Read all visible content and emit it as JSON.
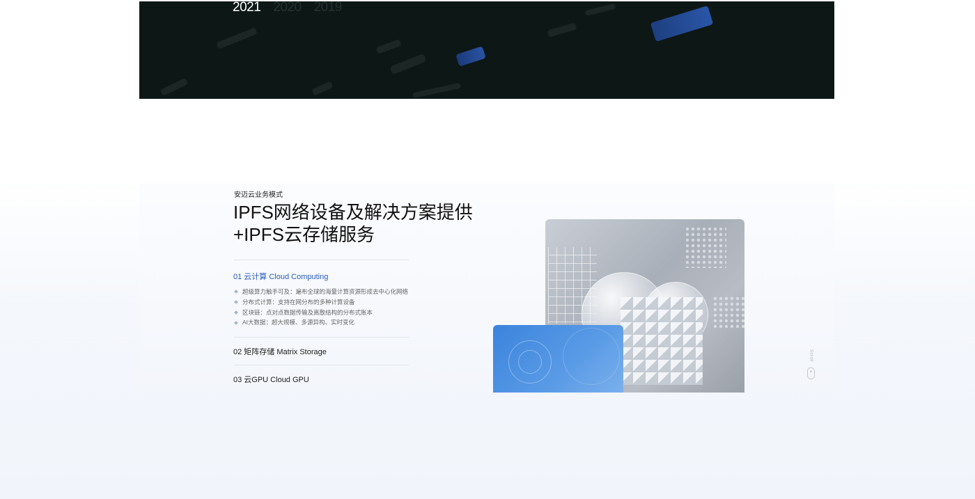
{
  "hero": {
    "years": [
      "2021",
      "2020",
      "2019"
    ],
    "active_year": "2021"
  },
  "section": {
    "eyebrow": "安迈云业务模式",
    "headline_line1": "IPFS网络设备及解决方案提供",
    "headline_line2": "+IPFS云存储服务"
  },
  "accordion": [
    {
      "title": "01 云计算 Cloud Computing",
      "expanded": true,
      "features": [
        "超级算力触手可及：遍布全球的海量计算资源形成去中心化网络",
        "分布式计算：支持在网分布的多种计算设备",
        "区块链：点对点数据传输及离散结构的分布式账本",
        "AI大数据：超大规模、多源异构、实时变化"
      ]
    },
    {
      "title": "02 矩阵存储 Matrix Storage",
      "expanded": false
    },
    {
      "title": "03 云GPU Cloud GPU",
      "expanded": false
    }
  ],
  "scroll_hint": {
    "label": "Scroll"
  },
  "colors": {
    "accent": "#2a5bbf",
    "hero_bg": "#0d1716",
    "card_blue": "#4a8fe0"
  },
  "icons": [
    "diamond-bullet-icon",
    "mouse-scroll-icon"
  ]
}
